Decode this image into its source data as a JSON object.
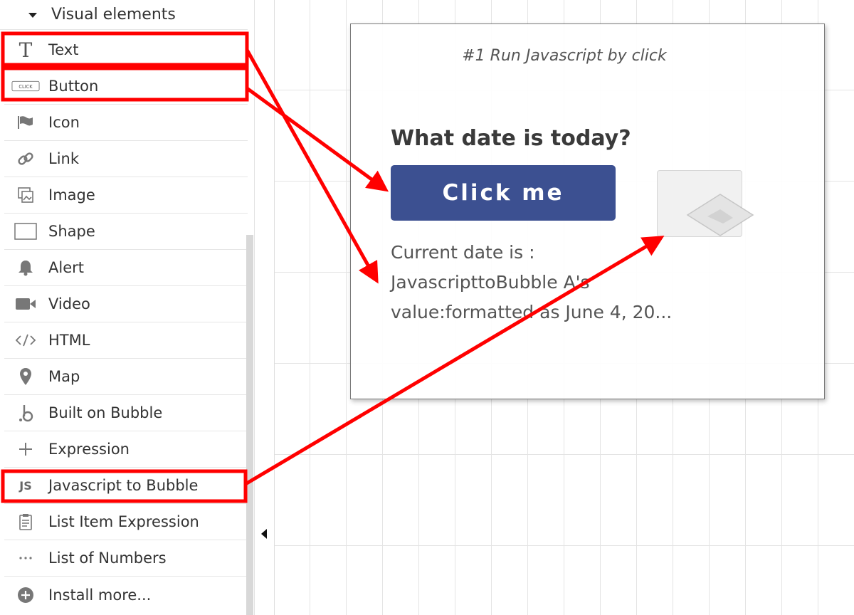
{
  "sidebar": {
    "section_label": "Visual elements",
    "items": [
      {
        "label": "Text",
        "icon": "text-icon"
      },
      {
        "label": "Button",
        "icon": "button-icon"
      },
      {
        "label": "Icon",
        "icon": "flag-icon"
      },
      {
        "label": "Link",
        "icon": "link-icon"
      },
      {
        "label": "Image",
        "icon": "image-icon"
      },
      {
        "label": "Shape",
        "icon": "shape-icon"
      },
      {
        "label": "Alert",
        "icon": "bell-icon"
      },
      {
        "label": "Video",
        "icon": "video-icon"
      },
      {
        "label": "HTML",
        "icon": "code-icon"
      },
      {
        "label": "Map",
        "icon": "map-pin-icon"
      },
      {
        "label": "Built on Bubble",
        "icon": "bubble-logo-icon"
      },
      {
        "label": "Expression",
        "icon": "plus-icon"
      },
      {
        "label": "Javascript to Bubble",
        "icon": "js-icon"
      },
      {
        "label": "List Item Expression",
        "icon": "clipboard-icon"
      },
      {
        "label": "List of Numbers",
        "icon": "ellipsis-icon"
      },
      {
        "label": "Install more...",
        "icon": "plus-circle-icon"
      }
    ]
  },
  "button_icon_text": "CLICK",
  "js_icon_text": "JS",
  "canvas": {
    "popup": {
      "title": "#1 Run Javascript by click",
      "question": "What date is today?",
      "button_label": "Click me",
      "date_line_1": "Current date is :",
      "date_line_2": "JavascripttoBubble A's",
      "date_line_3": "value:formatted as June 4, 20..."
    }
  },
  "annotation_color": "#ff0000"
}
